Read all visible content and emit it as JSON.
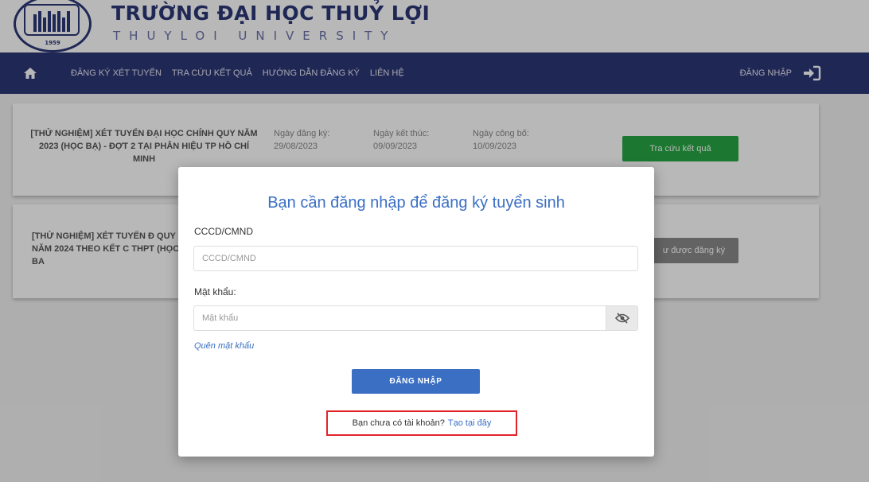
{
  "header": {
    "university_name": "TRƯỜNG ĐẠI HỌC THUỶ LỢI",
    "university_subtitle": "THUYLOI UNIVERSITY",
    "logo_year": "1959"
  },
  "nav": {
    "home_icon": "home-icon",
    "links": [
      "ĐĂNG KÝ XÉT TUYỂN",
      "TRA CỨU KẾT QUẢ",
      "HƯỚNG DẪN ĐĂNG KÝ",
      "LIÊN HỆ"
    ],
    "login_label": "ĐĂNG NHẬP",
    "login_icon": "sign-in-icon"
  },
  "cards": [
    {
      "title": "[THỬ NGHIỆM] XÉT TUYỂN ĐẠI HỌC CHÍNH QUY NĂM 2023 (HỌC BẠ) - ĐỢT 2 TẠI PHÂN HIỆU TP HỒ CHÍ MINH",
      "reg_date_label": "Ngày đăng ký:",
      "reg_date": "29/08/2023",
      "end_date_label": "Ngày kết thúc:",
      "end_date": "09/09/2023",
      "publish_date_label": "Ngày công bố:",
      "publish_date": "10/09/2023",
      "action_label": "Tra cứu kết quả"
    },
    {
      "title": "[THỬ NGHIỆM] XÉT TUYỂN Đ QUY NĂM 2024 THEO KẾT C THPT (HỌC BA",
      "action_label": "ư được đăng ký"
    }
  ],
  "modal": {
    "title": "Bạn cần đăng nhập để đăng ký tuyển sinh",
    "id_label": "CCCD/CMND",
    "id_placeholder": "CCCD/CMND",
    "password_label": "Mật khẩu:",
    "password_placeholder": "Mật khẩu",
    "toggle_icon": "eye-slash-icon",
    "forgot_password": "Quên mật khẩu",
    "login_button": "ĐĂNG NHẬP",
    "no_account_text": "Bạn chưa có tài khoản?",
    "create_link": "Tạo tại đây"
  },
  "colors": {
    "nav_bg": "#2b3677",
    "accent_blue": "#3a6fc4",
    "green": "#28a745",
    "highlight_red": "#e0242a"
  }
}
